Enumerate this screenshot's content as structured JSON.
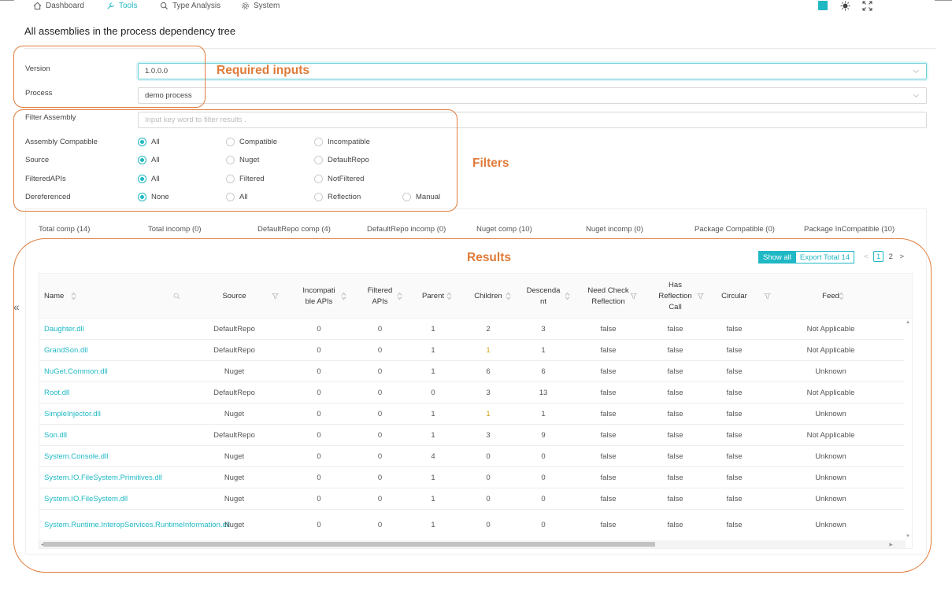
{
  "nav": {
    "items": [
      {
        "label": "Dashboard",
        "icon": "home-icon",
        "active": false
      },
      {
        "label": "Tools",
        "icon": "wrench-icon",
        "active": true
      },
      {
        "label": "Type Analysis",
        "icon": "search-icon",
        "active": false
      },
      {
        "label": "System",
        "icon": "gear-icon",
        "active": false
      }
    ],
    "accent": "#1fb8c4"
  },
  "page": {
    "title": "All assemblies in the process dependency tree"
  },
  "form": {
    "version_label": "Version",
    "version_value": "1.0.0.0",
    "process_label": "Process",
    "process_value": "demo process",
    "filter_label": "Filter Assembly",
    "filter_placeholder": "Input key word to filter results .",
    "compatible_label": "Assembly Compatible",
    "compatible_options": [
      "All",
      "Compatible",
      "Incompatible"
    ],
    "compatible_selected": "All",
    "source_label": "Source",
    "source_options": [
      "All",
      "Nuget",
      "DefaultRepo"
    ],
    "source_selected": "All",
    "filteredapis_label": "FilteredAPIs",
    "filteredapis_options": [
      "All",
      "Filtered",
      "NotFiltered"
    ],
    "filteredapis_selected": "All",
    "dereferenced_label": "Dereferenced",
    "dereferenced_options": [
      "None",
      "All",
      "Reflection",
      "Manual"
    ],
    "dereferenced_selected": "None"
  },
  "annotations": {
    "required": "Required inputs",
    "filters": "Filters",
    "results": "Results",
    "color": "#e07b39"
  },
  "stats": [
    "Total comp (14)",
    "Total incomp (0)",
    "DefaultRepo comp (4)",
    "DefaultRepo incomp (0)",
    "Nuget comp (10)",
    "Nuget incomp (0)",
    "Package Compatible (0)",
    "Package InCompatible (10)"
  ],
  "toolbar": {
    "show_all": "Show all",
    "export": "Export Total 14"
  },
  "pager": {
    "pages": [
      "1",
      "2"
    ],
    "current": "1",
    "prev": "<",
    "next": ">"
  },
  "collapse_label": "«",
  "table": {
    "headers": {
      "name": "Name",
      "source": "Source",
      "incompat": [
        "Incompati",
        "ble APIs"
      ],
      "filtered": [
        "Filtered",
        "APIs"
      ],
      "parent": "Parent",
      "children": "Children",
      "descendant": [
        "Descenda",
        "nt"
      ],
      "needcheck": [
        "Need Check",
        "Reflection"
      ],
      "hasreflection": [
        "Has",
        "Reflection",
        "Call"
      ],
      "circular": "Circular",
      "feed": "Feed"
    },
    "rows": [
      {
        "name": "Daughter.dll",
        "source": "DefaultRepo",
        "incompat": "0",
        "filtered": "0",
        "parent": "1",
        "children": "2",
        "descendant": "3",
        "needcheck": "false",
        "hasreflection": "false",
        "circular": "false",
        "feed": "Not Applicable"
      },
      {
        "name": "GrandSon.dll",
        "source": "DefaultRepo",
        "incompat": "0",
        "filtered": "0",
        "parent": "1",
        "children": "1",
        "descendant": "1",
        "needcheck": "false",
        "hasreflection": "false",
        "circular": "false",
        "feed": "Not Applicable"
      },
      {
        "name": "NuGet.Common.dll",
        "source": "Nuget",
        "incompat": "0",
        "filtered": "0",
        "parent": "1",
        "children": "6",
        "descendant": "6",
        "needcheck": "false",
        "hasreflection": "false",
        "circular": "false",
        "feed": "Unknown"
      },
      {
        "name": "Root.dll",
        "source": "DefaultRepo",
        "incompat": "0",
        "filtered": "0",
        "parent": "0",
        "children": "3",
        "descendant": "13",
        "needcheck": "false",
        "hasreflection": "false",
        "circular": "false",
        "feed": "Not Applicable"
      },
      {
        "name": "SimpleInjector.dll",
        "source": "Nuget",
        "incompat": "0",
        "filtered": "0",
        "parent": "1",
        "children": "1",
        "descendant": "1",
        "needcheck": "false",
        "hasreflection": "false",
        "circular": "false",
        "feed": "Unknown"
      },
      {
        "name": "Son.dll",
        "source": "DefaultRepo",
        "incompat": "0",
        "filtered": "0",
        "parent": "1",
        "children": "3",
        "descendant": "9",
        "needcheck": "false",
        "hasreflection": "false",
        "circular": "false",
        "feed": "Not Applicable"
      },
      {
        "name": "System.Console.dll",
        "source": "Nuget",
        "incompat": "0",
        "filtered": "0",
        "parent": "4",
        "children": "0",
        "descendant": "0",
        "needcheck": "false",
        "hasreflection": "false",
        "circular": "false",
        "feed": "Unknown"
      },
      {
        "name": "System.IO.FileSystem.Primitives.dll",
        "source": "Nuget",
        "incompat": "0",
        "filtered": "0",
        "parent": "1",
        "children": "0",
        "descendant": "0",
        "needcheck": "false",
        "hasreflection": "false",
        "circular": "false",
        "feed": "Unknown"
      },
      {
        "name": "System.IO.FileSystem.dll",
        "source": "Nuget",
        "incompat": "0",
        "filtered": "0",
        "parent": "1",
        "children": "0",
        "descendant": "0",
        "needcheck": "false",
        "hasreflection": "false",
        "circular": "false",
        "feed": "Unknown"
      },
      {
        "name": "System.Runtime.InteropServices.RuntimeInformation.dll",
        "source": "Nuget",
        "incompat": "0",
        "filtered": "0",
        "parent": "1",
        "children": "0",
        "descendant": "0",
        "needcheck": "false",
        "hasreflection": "false",
        "circular": "false",
        "feed": "Unknown"
      }
    ]
  }
}
